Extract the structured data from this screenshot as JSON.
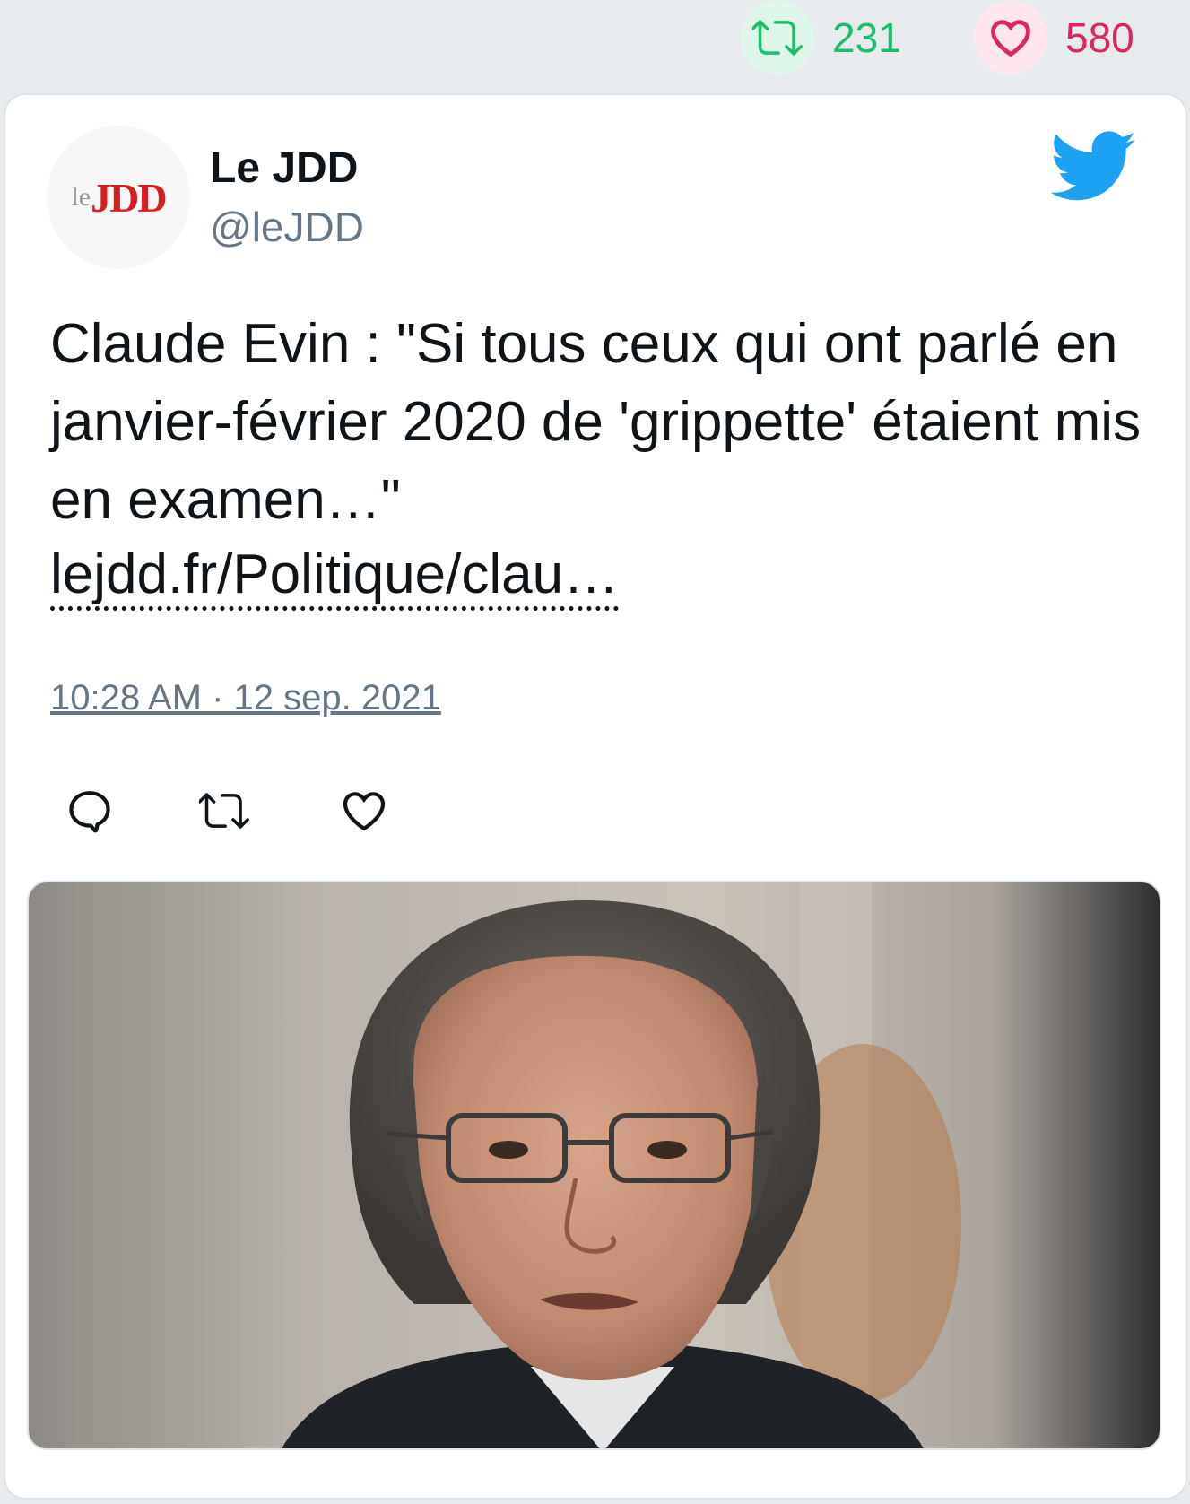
{
  "stats": {
    "retweets": "231",
    "likes": "580",
    "retweet_color": "#19bf6b",
    "like_color": "#e0245e"
  },
  "author": {
    "name": "Le JDD",
    "handle": "@leJDD",
    "avatar_logo": {
      "le": "le",
      "jdd": "JDD"
    }
  },
  "tweet": {
    "text": "Claude Evin : \"Si tous ceux qui ont parlé en janvier-février 2020 de 'grippette' étaient mis en examen…\"",
    "link_text": "lejdd.fr/Politique/clau…",
    "timestamp": "10:28 AM · 12 sep. 2021"
  },
  "icons": {
    "top_retweet": "retweet-icon",
    "top_like": "heart-icon",
    "brand": "twitter-bird-icon",
    "reply": "reply-icon",
    "retweet": "retweet-icon",
    "like": "heart-icon"
  },
  "media": {
    "kind": "photo-portrait"
  }
}
